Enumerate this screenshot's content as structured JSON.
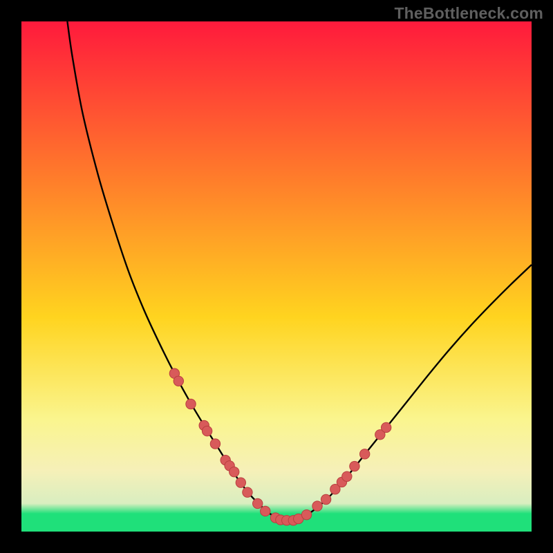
{
  "watermark": "TheBottleneck.com",
  "colors": {
    "frame": "#000000",
    "grad_top": "#ff1a3c",
    "grad_mid_up": "#ff7a2b",
    "grad_mid": "#ffd41f",
    "grad_low1": "#faf58e",
    "grad_low2": "#f6f0b8",
    "grad_band": "#d9eec0",
    "grad_green": "#1fe07a",
    "curve": "#000000",
    "dot_fill": "#d85a5a",
    "dot_stroke": "#b93f3f"
  },
  "chart_data": {
    "type": "line",
    "title": "",
    "xlabel": "",
    "ylabel": "",
    "xlim": [
      0,
      100
    ],
    "ylim": [
      0,
      100
    ],
    "series": [
      {
        "name": "curve",
        "x": [
          9,
          10,
          12,
          15,
          18,
          21,
          24,
          27,
          30,
          33,
          36,
          38.5,
          41,
          43,
          45,
          47,
          49,
          51,
          53,
          56,
          60,
          64,
          68,
          72,
          76,
          80,
          84,
          88,
          92,
          96,
          100
        ],
        "y": [
          100,
          93,
          82,
          70,
          60,
          51,
          43.5,
          37,
          31,
          25.5,
          20.5,
          16.5,
          12.5,
          9.5,
          7,
          5,
          3.3,
          2.2,
          2.2,
          3.3,
          6.5,
          11,
          16,
          21,
          26,
          31,
          35.8,
          40.3,
          44.5,
          48.5,
          52.3
        ]
      }
    ],
    "dots": [
      {
        "x": 30.0,
        "y": 31.0
      },
      {
        "x": 30.8,
        "y": 29.5
      },
      {
        "x": 33.2,
        "y": 25.0
      },
      {
        "x": 35.8,
        "y": 20.8
      },
      {
        "x": 36.4,
        "y": 19.7
      },
      {
        "x": 38.0,
        "y": 17.2
      },
      {
        "x": 40.0,
        "y": 14.0
      },
      {
        "x": 40.8,
        "y": 12.9
      },
      {
        "x": 41.7,
        "y": 11.7
      },
      {
        "x": 43.0,
        "y": 9.6
      },
      {
        "x": 44.3,
        "y": 7.7
      },
      {
        "x": 46.3,
        "y": 5.5
      },
      {
        "x": 47.8,
        "y": 4.0
      },
      {
        "x": 49.8,
        "y": 2.7
      },
      {
        "x": 50.8,
        "y": 2.3
      },
      {
        "x": 52.0,
        "y": 2.2
      },
      {
        "x": 53.3,
        "y": 2.2
      },
      {
        "x": 54.3,
        "y": 2.5
      },
      {
        "x": 55.9,
        "y": 3.3
      },
      {
        "x": 58.0,
        "y": 5.0
      },
      {
        "x": 59.7,
        "y": 6.3
      },
      {
        "x": 61.5,
        "y": 8.3
      },
      {
        "x": 62.8,
        "y": 9.7
      },
      {
        "x": 63.8,
        "y": 10.8
      },
      {
        "x": 65.3,
        "y": 12.8
      },
      {
        "x": 67.3,
        "y": 15.2
      },
      {
        "x": 70.3,
        "y": 19.0
      },
      {
        "x": 71.5,
        "y": 20.4
      }
    ]
  }
}
